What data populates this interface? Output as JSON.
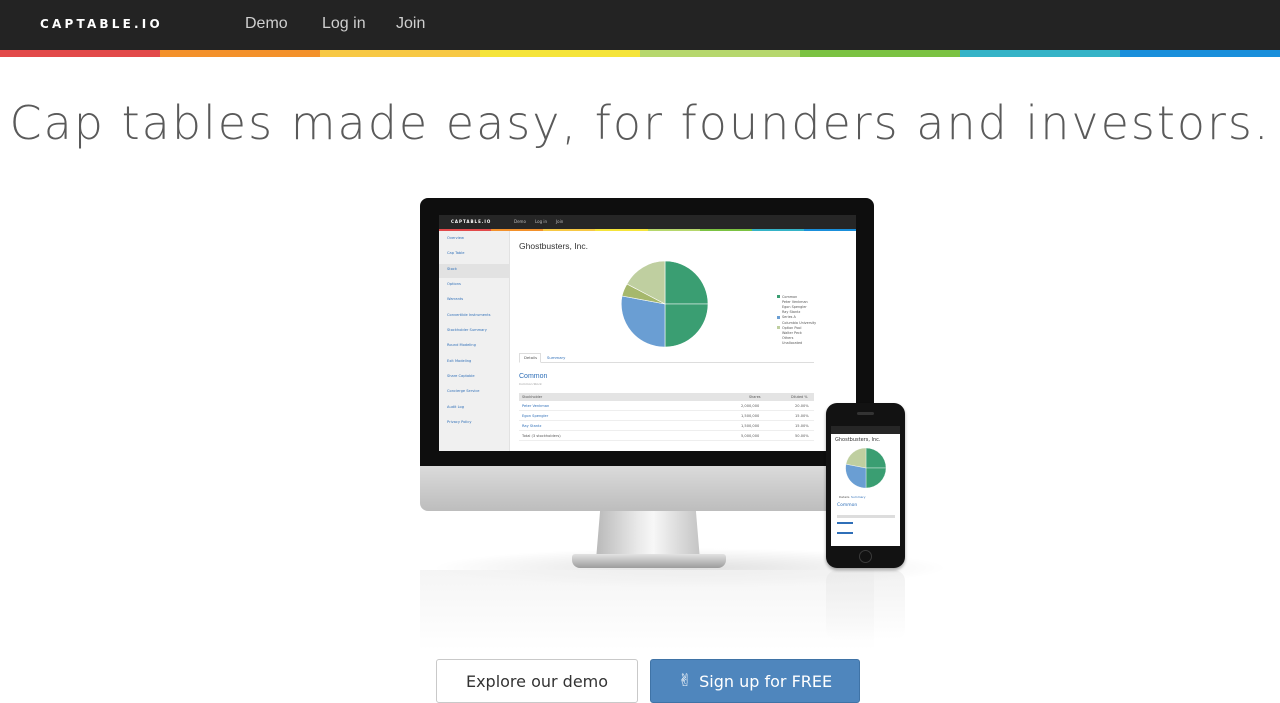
{
  "nav": {
    "brand": "CAPTABLE.IO",
    "links": [
      "Demo",
      "Log in",
      "Join"
    ]
  },
  "rainbow_colors": [
    "#e24a4a",
    "#f3912b",
    "#f7c844",
    "#f5e43a",
    "#b6d76d",
    "#7bc242",
    "#35b3c7",
    "#1a8fdb"
  ],
  "headline": "Cap tables made easy, for founders and investors.",
  "mockup": {
    "brand": "CAPTABLE.IO",
    "nav_links": [
      "Demo",
      "Log in",
      "Join"
    ],
    "sidebar": [
      "Overview",
      "Cap Table",
      "Stock",
      "Options",
      "Warrants",
      "Convertible Instruments",
      "Stockholder Summary",
      "Round Modeling",
      "Exit Modeling",
      "Share Captable",
      "Concierge Service",
      "Audit Log",
      "Privacy Policy"
    ],
    "company": "Ghostbusters, Inc.",
    "legend": [
      "Common",
      "Peter Venkman",
      "Egon Spengler",
      "Ray Stantz",
      "Series A",
      "Columbia University",
      "Option Pool",
      "Walter Peck",
      "Others",
      "Unallocated"
    ],
    "tabs": [
      "Details",
      "Summary"
    ],
    "section": "Common",
    "section_sub": "Common Stock",
    "table_headers": [
      "Stockholder",
      "Shares",
      "Diluted %"
    ],
    "rows": [
      [
        "Peter Venkman",
        "2,000,000",
        "20.00%"
      ],
      [
        "Egon Spengler",
        "1,500,000",
        "15.00%"
      ],
      [
        "Ray Stantz",
        "1,500,000",
        "15.00%"
      ],
      [
        "Total (3 stockholders)",
        "5,000,000",
        "50.00%"
      ]
    ],
    "phone_title": "Ghostbusters, Inc.",
    "phone_tabs": [
      "Details",
      "Summary"
    ],
    "phone_section": "Common"
  },
  "buttons": {
    "demo": "Explore our demo",
    "signup": "Sign up for FREE",
    "signup_icon": "peace-hand-icon"
  },
  "colors": {
    "nav_bg": "#232323",
    "signup_bg": "#4f86bd",
    "pie_green": "#3a9e72",
    "pie_blue": "#6a9ed3",
    "pie_light": "#bfcfa0",
    "link_blue": "#2f6fb8"
  }
}
